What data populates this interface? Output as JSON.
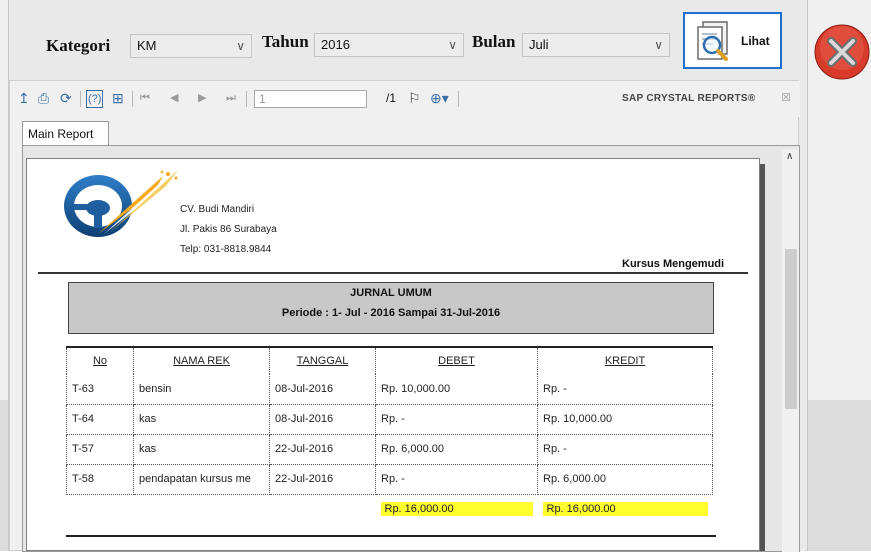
{
  "filters": {
    "kategori_label": "Kategori",
    "kategori_value": "KM",
    "tahun_label": "Tahun",
    "tahun_value": "2016",
    "bulan_label": "Bulan",
    "bulan_value": "Juli",
    "lihat_label": "Lihat"
  },
  "viewer": {
    "page_current": "1",
    "page_total": "/1",
    "brand": "SAP CRYSTAL REPORTS®",
    "tab_main": "Main Report"
  },
  "report": {
    "company_name": "CV. Budi Mandiri",
    "company_address": "Jl. Pakis 86 Surabaya",
    "company_phone": "Telp: 031-8818.9844",
    "right_header": "Kursus Mengemudi",
    "title": "JURNAL UMUM",
    "period": "Periode : 1- Jul  - 2016   Sampai  31-Jul-2016",
    "columns": [
      "No",
      "NAMA REK",
      "TANGGAL",
      "DEBET",
      "KREDIT"
    ],
    "rows": [
      [
        "T-63",
        "bensin",
        "08-Jul-2016",
        "Rp. 10,000.00",
        "Rp. -"
      ],
      [
        "T-64",
        "kas",
        "08-Jul-2016",
        "Rp. -",
        "Rp. 10,000.00"
      ],
      [
        "T-57",
        "kas",
        "22-Jul-2016",
        "Rp. 6,000.00",
        "Rp. -"
      ],
      [
        "T-58",
        "pendapatan kursus me",
        "22-Jul-2016",
        "Rp. -",
        "Rp. 6,000.00"
      ]
    ],
    "total_debet": "Rp. 16,000.00",
    "total_kredit": "Rp. 16,000.00"
  },
  "colors": {
    "accent": "#1f6fd1",
    "highlight": "#ffff2e",
    "close_red": "#d93b2b"
  }
}
